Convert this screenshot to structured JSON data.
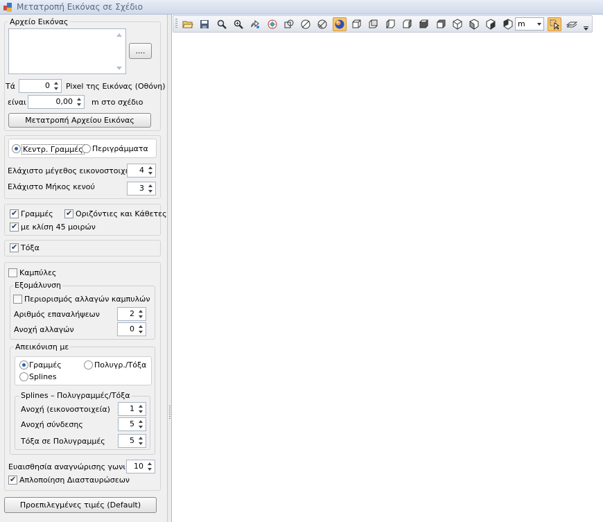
{
  "window": {
    "title": "Μετατροπή Εικόνας σε Σχέδιο"
  },
  "image_file": {
    "legend": "Αρχείο Εικόνας",
    "browse_label": "...."
  },
  "scale": {
    "prefix_label": "Τά",
    "pixels_value": "0",
    "pixels_label": "Pixel της Εικόνας (Οθόνη)",
    "equals_label": "είναι",
    "meters_value": "0,00",
    "meters_label": "m στο σχέδιο",
    "convert_button": "Μετατροπή Αρχείου Εικόνας"
  },
  "mode": {
    "center_lines": "Κεντρ. Γραμμές",
    "outlines": "Περιγράμματα",
    "selected": "center_lines"
  },
  "min_pixel_size": {
    "label": "Ελάχιστο μέγεθος εικονοστοιχείου",
    "value": "4"
  },
  "min_gap_length": {
    "label": "Ελάχιστο Μήκος κενού",
    "value": "3"
  },
  "lines": {
    "lines_label": "Γραμμές",
    "lines_checked": true,
    "orthogonal_label": "Οριζόντιες και Κάθετες",
    "orthogonal_checked": true,
    "diag45_label": "με κλίση 45 μοιρών",
    "diag45_checked": true
  },
  "arcs": {
    "label": "Τόξα",
    "checked": true
  },
  "curves": {
    "label": "Καμπύλες",
    "checked": false,
    "smoothing": {
      "legend": "Εξομάλυνση",
      "limit_label": "Περιορισμός αλλαγών καμπυλών",
      "limit_checked": false,
      "iterations_label": "Αριθμός επαναλήψεων",
      "iterations_value": "2",
      "tolerance_label": "Ανοχή αλλαγών",
      "tolerance_value": "0"
    },
    "display": {
      "legend": "Απεικόνιση με",
      "lines": "Γραμμές",
      "polyarcs": "Πολυγρ./Τόξα",
      "splines": "Splines",
      "selected": "lines",
      "sub": {
        "legend": "Splines – Πολυγραμμές/Τόξα",
        "pixel_tol_label": "Ανοχή (εικονοστοιχεία)",
        "pixel_tol_value": "1",
        "join_tol_label": "Ανοχή σύνδεσης",
        "join_tol_value": "5",
        "arcs_to_poly_label": "Τόξα σε Πολυγραμμές",
        "arcs_to_poly_value": "5"
      }
    }
  },
  "corner_sensitivity": {
    "label": "Ευαισθησία αναγνώρισης γωνιών",
    "value": "10"
  },
  "simplify_crossings": {
    "label": "Απλοποίηση Διασταυρώσεων",
    "checked": true
  },
  "default_button": "Προεπιλεγμένες τιμές (Default)",
  "toolbar": {
    "unit_value": "m",
    "buttons": [
      {
        "name": "open-folder-icon"
      },
      {
        "name": "save-icon"
      },
      {
        "name": "zoom-icon"
      },
      {
        "name": "zoom-extents-icon"
      },
      {
        "name": "pan-icon"
      },
      {
        "name": "render-mode-icon"
      },
      {
        "name": "wireframe-icon"
      },
      {
        "name": "hidden-line-icon"
      },
      {
        "name": "shaded-icon"
      },
      {
        "name": "sphere-render-icon"
      },
      {
        "name": "view-front-icon"
      },
      {
        "name": "view-back-icon"
      },
      {
        "name": "view-left-icon"
      },
      {
        "name": "view-right-icon"
      },
      {
        "name": "view-top-icon"
      },
      {
        "name": "view-bottom-icon"
      },
      {
        "name": "iso-sw-icon"
      },
      {
        "name": "iso-se-icon"
      },
      {
        "name": "iso-ne-icon"
      },
      {
        "name": "iso-nw-icon"
      }
    ]
  }
}
